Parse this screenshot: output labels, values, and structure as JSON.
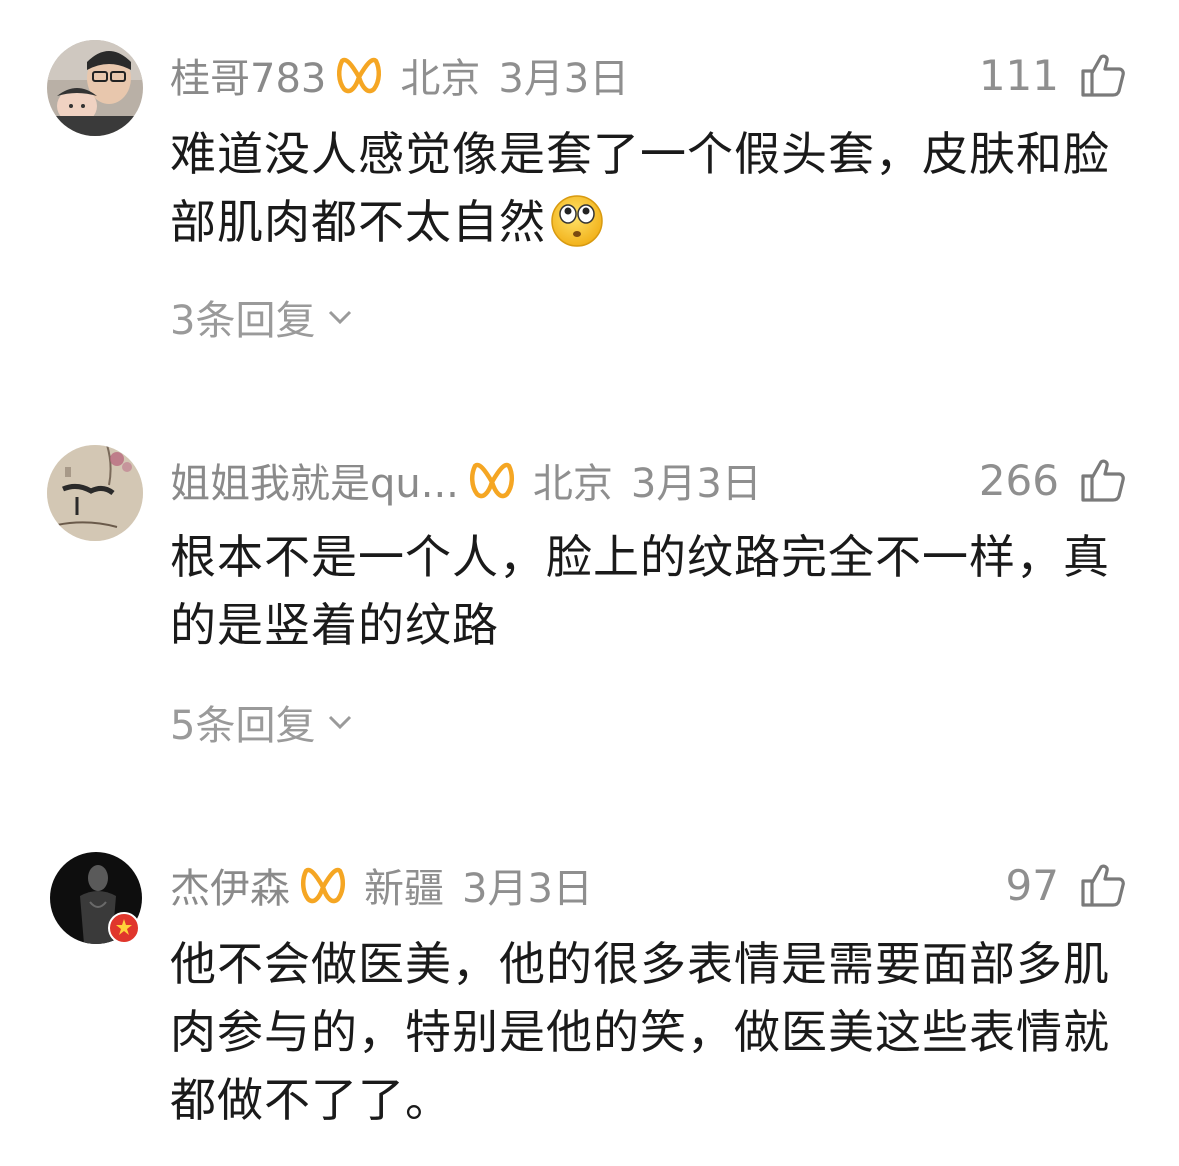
{
  "comments": [
    {
      "username": "桂哥783",
      "location": "北京",
      "date": "3月3日",
      "likes": "111",
      "text": "难道没人感觉像是套了一个假头套，皮肤和脸部肌肉都不太自然",
      "replies": "3条回复",
      "avatar_icon": "avatar-man-with-baby-icon"
    },
    {
      "username": "姐姐我就是qu...",
      "location": "北京",
      "date": "3月3日",
      "likes": "266",
      "text": "根本不是一个人，脸上的纹路完全不一样，真的是竖着的纹路",
      "replies": "5条回复",
      "avatar_icon": "avatar-ink-painting-icon"
    },
    {
      "username": "杰伊森",
      "location": "新疆",
      "date": "3月3日",
      "likes": "97",
      "text": "他不会做医美，他的很多表情是需要面部多肌肉参与的，特别是他的笑，做医美这些表情就都做不了了。",
      "replies": "",
      "avatar_icon": "avatar-dark-portrait-icon"
    }
  ],
  "colors": {
    "vip_badge": "#f5a623",
    "meta_text": "#8f8f8f",
    "body_text": "#1a1a1a"
  }
}
